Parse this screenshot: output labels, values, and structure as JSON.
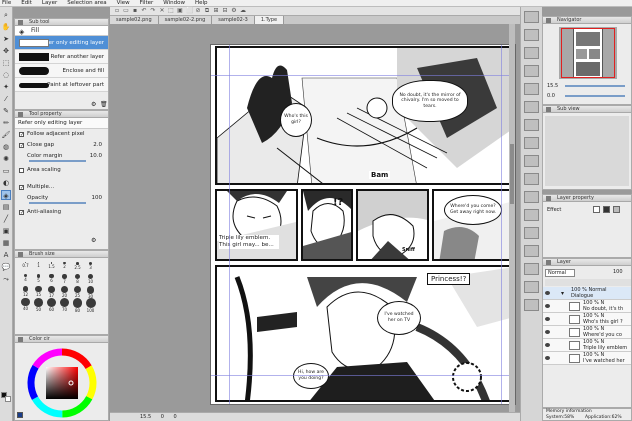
{
  "menu": [
    "File",
    "Edit",
    "Layer",
    "Selection area",
    "View",
    "Filter",
    "Window",
    "Help"
  ],
  "tabs": [
    "sample02.png",
    "sample02-2.png",
    "sample02-3",
    "1.Type"
  ],
  "sub_tool": {
    "title": "Sub tool",
    "group": "Fill",
    "items": [
      "Refer only editing layer",
      "Refer another layer",
      "Enclose and fill",
      "Paint at leftover part"
    ]
  },
  "tool_property": {
    "title": "Tool property",
    "tool_name": "Refer only editing layer",
    "follow_adjacent": "Follow adjacent pixel",
    "close_gap": "Close gap",
    "close_gap_value": "2.0",
    "color_margin": "Color margin",
    "color_margin_value": "10.0",
    "area_scaling": "Area scaling",
    "multiple": "Multiple...",
    "opacity": "Opacity",
    "opacity_value": "100",
    "anti_aliasing": "Anti-aliasing"
  },
  "brush_size": {
    "title": "Brush size",
    "sizes": [
      "0.7",
      "1",
      "1.5",
      "2",
      "2.5",
      "3",
      "4",
      "5",
      "6",
      "7",
      "8",
      "10",
      "12",
      "15",
      "17",
      "20",
      "25",
      "30",
      "40",
      "50",
      "60",
      "70",
      "80",
      "100"
    ]
  },
  "color_circle": {
    "title": "Color cir",
    "selected_color": "#7a1a1a"
  },
  "comic": {
    "bubble1": "Who's this girl?",
    "bubble2": "No doubt, it's the mirror of chivalry. I'm so moved to tears.",
    "sfx_bam": "Bam",
    "caption1": "Triple lily emblem. This girl may... be...",
    "sfx_surprise": "!?",
    "bubble3": "Where'd you come? Get away right now.",
    "sfx_sniff": "Sniff",
    "sfx_princess": "Princess!?",
    "bubble4": "I've watched her on TV",
    "bubble5": "Hi, how are you doing?"
  },
  "status": {
    "zoom": "15.5",
    "x": "0",
    "y": "0"
  },
  "navigator": {
    "title": "Navigator",
    "zoom": "15.5",
    "angle": "0.0"
  },
  "subview": {
    "title": "Sub view"
  },
  "layer_property": {
    "title": "Layer property",
    "effect": "Effect"
  },
  "layer": {
    "title": "Layer",
    "blend_mode": "Normal",
    "opacity": "100",
    "items": [
      {
        "pct": "100 %  Normal",
        "name": "Dialogue",
        "folder": true
      },
      {
        "pct": "100 %  N",
        "name": "No doubt, it's th"
      },
      {
        "pct": "100 %  N",
        "name": "Who's this girl ?"
      },
      {
        "pct": "100 %  N",
        "name": "Where'd you co"
      },
      {
        "pct": "100 %  N",
        "name": "Triple lily emblem"
      },
      {
        "pct": "100 %  N",
        "name": "I've watched her"
      }
    ]
  },
  "memory": {
    "title": "Memory information",
    "system": "System:58%",
    "application": "Application:62%"
  }
}
